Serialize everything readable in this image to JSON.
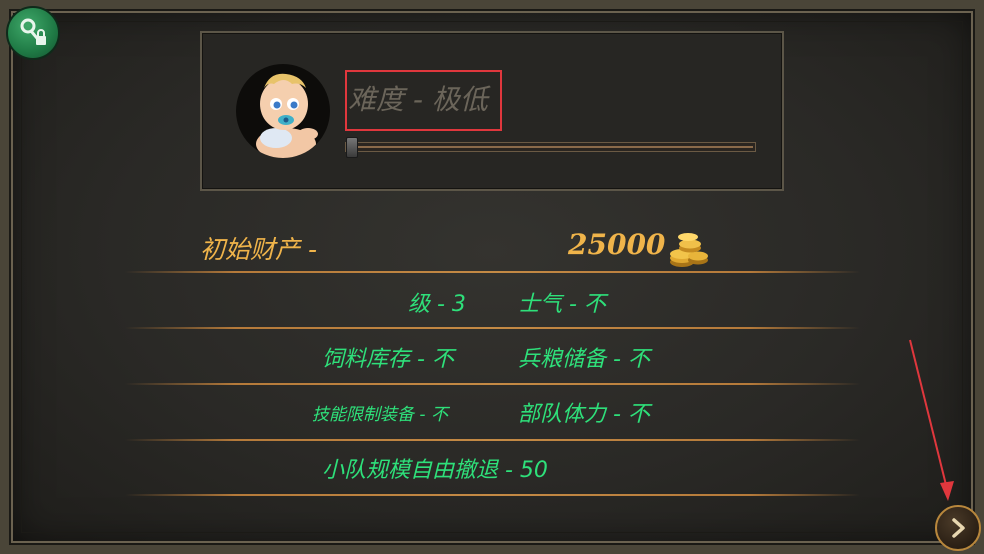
{
  "difficulty": {
    "label": "难度 - 极低",
    "level_fraction": 0
  },
  "wealth": {
    "label": "初始财产 -",
    "value": "25000"
  },
  "stats": {
    "level": "级 - 3",
    "morale": "士气 - 不",
    "fodder": "饲料库存 - 不",
    "provisions": "兵粮储备 - 不",
    "skill_limit": "技能限制装备 - 不",
    "stamina": "部队体力 - 不",
    "retreat": "小队规模自由撤退 - 50"
  },
  "icons": {
    "corner": "key-lock-icon",
    "avatar": "baby-avatar",
    "coins": "gold-coins-icon",
    "next": "chevron-right-icon"
  },
  "colors": {
    "accent_gold": "#f0b44a",
    "stat_green": "#2ee07a",
    "highlight_red": "#e0373d"
  }
}
